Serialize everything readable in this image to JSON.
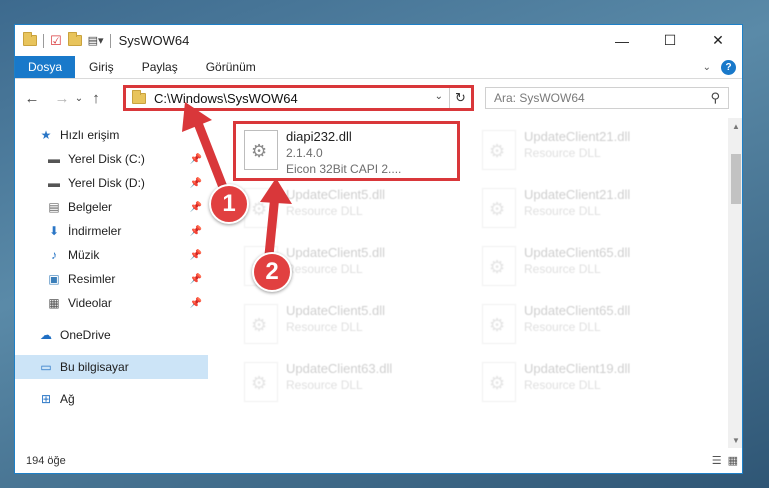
{
  "window": {
    "title": "SysWOW64",
    "controls": {
      "minimize": "—",
      "maximize": "☐",
      "close": "✕"
    }
  },
  "ribbon": {
    "tabs": [
      "Dosya",
      "Giriş",
      "Paylaş",
      "Görünüm"
    ],
    "help": "?"
  },
  "nav": {
    "back": "←",
    "forward": "→",
    "recent": "⌄",
    "up": "↑",
    "address": "C:\\Windows\\SysWOW64",
    "refresh": "↻",
    "search_placeholder": "Ara: SysWOW64"
  },
  "sidebar": {
    "items": [
      {
        "label": "Hızlı erişim",
        "icon": "star-icon",
        "pinned": false
      },
      {
        "label": "Yerel Disk (C:)",
        "icon": "disk-icon",
        "pinned": true
      },
      {
        "label": "Yerel Disk (D:)",
        "icon": "disk-icon",
        "pinned": true
      },
      {
        "label": "Belgeler",
        "icon": "documents-icon",
        "pinned": true
      },
      {
        "label": "İndirmeler",
        "icon": "download-icon",
        "pinned": true
      },
      {
        "label": "Müzik",
        "icon": "music-icon",
        "pinned": true
      },
      {
        "label": "Resimler",
        "icon": "pictures-icon",
        "pinned": true
      },
      {
        "label": "Videolar",
        "icon": "video-icon",
        "pinned": true
      },
      {
        "label": "OneDrive",
        "icon": "cloud-icon",
        "pinned": false
      },
      {
        "label": "Bu bilgisayar",
        "icon": "computer-icon",
        "pinned": false
      },
      {
        "label": "Ağ",
        "icon": "network-icon",
        "pinned": false
      }
    ]
  },
  "files": [
    {
      "name": "diapi232.dll",
      "line2": "2.1.4.0",
      "line3": "Eicon 32Bit CAPI 2....",
      "highlighted": true
    },
    {
      "name": "UpdateClient21.dll",
      "line2": "Resource DLL",
      "line3": ""
    },
    {
      "name": "UpdateClient5.dll",
      "line2": "Resource DLL",
      "line3": ""
    },
    {
      "name": "UpdateClient21.dll",
      "line2": "Resource DLL",
      "line3": ""
    },
    {
      "name": "UpdateClient5.dll",
      "line2": "Resource DLL",
      "line3": ""
    },
    {
      "name": "UpdateClient65.dll",
      "line2": "Resource DLL",
      "line3": ""
    },
    {
      "name": "UpdateClient5.dll",
      "line2": "Resource DLL",
      "line3": ""
    },
    {
      "name": "UpdateClient65.dll",
      "line2": "Resource DLL",
      "line3": ""
    },
    {
      "name": "UpdateClient63.dll",
      "line2": "Resource DLL",
      "line3": ""
    },
    {
      "name": "UpdateClient19.dll",
      "line2": "Resource DLL",
      "line3": ""
    }
  ],
  "status": {
    "count": "194 öğe"
  },
  "annotations": {
    "step1": "1",
    "step2": "2",
    "color": "#d9373a"
  }
}
